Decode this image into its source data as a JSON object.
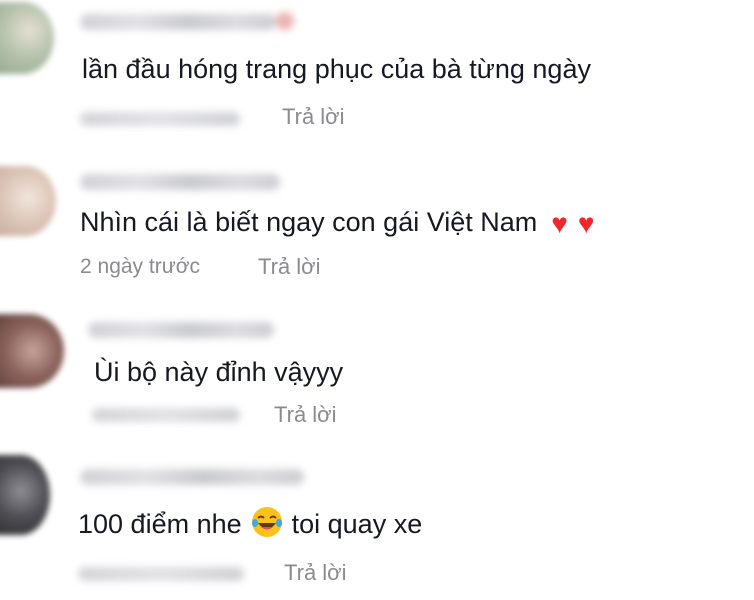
{
  "comments": [
    {
      "text": "lần đầu hóng trang phục của bà từng ngày",
      "time": "",
      "time_blurred": true,
      "reply_label": "Trả lời",
      "avatar_colors": [
        "#9fb19a",
        "#e7e2d6"
      ]
    },
    {
      "text": "Nhìn cái là biết ngay con gái Việt Nam",
      "emoji": [
        "♥",
        "♥"
      ],
      "emoji_icon": "heart-icon",
      "time": "2 ngày trước",
      "time_blurred": false,
      "reply_label": "Trả lời",
      "avatar_colors": [
        "#d9c4b8",
        "#eadbd0"
      ]
    },
    {
      "text": "Ùi bộ này đỉnh vậyyy",
      "time": "",
      "time_blurred": true,
      "reply_label": "Trả lời",
      "avatar_colors": [
        "#6b4a45",
        "#b89890"
      ]
    },
    {
      "text_before": "100 điểm nhe",
      "emoji_icon": "laughing-tears-emoji-icon",
      "text_after": "toi quay xe",
      "time": "",
      "time_blurred": true,
      "reply_label": "Trả lời",
      "avatar_colors": [
        "#3a3a3e",
        "#77777d"
      ]
    }
  ],
  "colors": {
    "text": "#161823",
    "muted": "#8a8b91",
    "heart": "#f0282e",
    "background": "#ffffff"
  }
}
